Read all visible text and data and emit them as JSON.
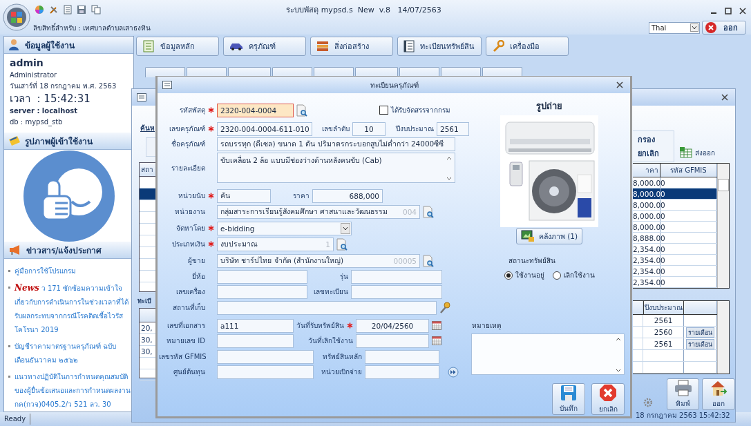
{
  "window": {
    "title": "ระบบพัสดุ mypsd.s  New  v.8   14/07/2563",
    "license": "ลิขสิทธิ์สำหรับ : เทศบาลตำบลเสาธงหิน",
    "language": "Thai",
    "exit": "ออก"
  },
  "user_panel": {
    "heading": "ข้อมูลผู้ใช้งาน",
    "username": "admin",
    "role": "Administrator",
    "date": "วันเสาร์ที่ 18 กรกฎาคม พ.ศ. 2563",
    "time": "เวลา  : 15:42:31",
    "server": "server : localhost",
    "db": "db : mypsd_stb",
    "photo_heading": "รูปภาพผู้เข้าใช้งาน",
    "news_heading": "ข่าวสาร/แจ้งประกาศ",
    "news": [
      {
        "text": "คู่มือการใช้โปรแกรม"
      },
      {
        "badge": "News",
        "text": "ว 171 ซักซ้อมความเข้าใจเกี่ยวกับการดำเนินการในช่วงเวลาที่ได้รับผลกระทบจากกรณีโรคติดเชื้อไวรัสโคโรนา 2019"
      },
      {
        "text": "บัญชีราคามาตรฐานครุภัณฑ์ ฉบับเดือนธันวาคม ๒๕๖๒"
      },
      {
        "text": "แนวทางปฏิบัติในการกำหนดคุณสมบัติของผู้ยื่นข้อเสนอและการกำหนดผลงาน กค(กวจ)0405.2/ว 521 ลว. 30"
      }
    ]
  },
  "menu": [
    "ข้อมูลหลัก",
    "ครุภัณฑ์",
    "สิ่งก่อสร้าง",
    "ทะเบียนทรัพย์สิน",
    "เครื่องมือ"
  ],
  "list_window": {
    "search_label": "ค้นห",
    "filter": "กรอง",
    "clear": "ยกเลิก",
    "export": "ส่งออก",
    "columns": [
      "สถา",
      "าคา",
      "รหัส GFMIS"
    ],
    "rows": [
      {
        "price": "8,000.00",
        "selected": false
      },
      {
        "price": "8,000.00",
        "selected": true
      },
      {
        "price": "8,000.00",
        "selected": false
      },
      {
        "price": "8,000.00",
        "selected": false
      },
      {
        "price": "8,000.00",
        "selected": false
      },
      {
        "price": "8,888.00",
        "selected": false
      },
      {
        "price": "2,354.00",
        "selected": false
      },
      {
        "price": "2,354.00",
        "selected": false
      },
      {
        "price": "2,354.00",
        "selected": false
      },
      {
        "price": "2,354.00",
        "selected": false
      }
    ],
    "history_label": "ทะเบี",
    "history_columns": [
      "ปีงบประมาณ"
    ],
    "history_rows": [
      {
        "amount": "20,",
        "year": "2561"
      },
      {
        "amount": "30,",
        "year": "2560",
        "action": "รายเดือน"
      },
      {
        "amount": "30,",
        "year": "2561",
        "action": "รายเดือน"
      }
    ],
    "print": "พิมพ์",
    "exit": "ออก",
    "timestamp": "18 กรกฎาคม 2563 15:42:32"
  },
  "dialog": {
    "title": "ทะเบียนครุภัณฑ์",
    "rows": [
      {
        "fields": [
          {
            "kind": "text",
            "label": "รหัสพัสดุ",
            "required": true,
            "value": "2320-004-0004",
            "highlighted": true,
            "button": {
              "kind": "lookup"
            }
          },
          {
            "kind": "checkbox",
            "label": "ได้รับจัดสรรจากกรม",
            "checked": false
          }
        ]
      },
      {
        "fields": [
          {
            "kind": "text",
            "label": "เลขครุภัณฑ์",
            "required": true,
            "value": "2320-004-0004-611-010"
          },
          {
            "kind": "text",
            "label": "เลขลำดับ",
            "value": "10"
          },
          {
            "kind": "text",
            "label": "ปีงบประมาณ",
            "value": "2561"
          }
        ]
      },
      {
        "fields": [
          {
            "kind": "text",
            "label": "ชื่อครุภัณฑ์",
            "value": "รถบรรทุก (ดีเซล) ขนาด 1 ตัน ปริมาตรกระบอกสูบไม่ต่ำกว่า 24000ซีซี"
          }
        ]
      },
      {
        "fields": [
          {
            "kind": "textarea",
            "label": "รายละเอียด",
            "value": "ขับเคลื่อน 2 ล้อ แบบมีช่องว่างด้านหลังคนขับ (Cab)"
          }
        ]
      },
      {
        "fields": [
          {
            "kind": "text",
            "label": "หน่วยนับ",
            "required": true,
            "value": "คัน"
          },
          {
            "kind": "text",
            "label": "ราคา",
            "value": "688,000"
          }
        ]
      },
      {
        "fields": [
          {
            "kind": "text",
            "label": "หน่วยงาน",
            "value": "กลุ่มสาระการเรียนรู้สังคมศึกษา  ศาสนาและวัฒนธรรม",
            "code": "004",
            "button": {
              "kind": "lookup"
            }
          }
        ]
      },
      {
        "fields": [
          {
            "kind": "select",
            "label": "จัดหาโดย",
            "required": true,
            "value": "e-bidding"
          }
        ]
      },
      {
        "fields": [
          {
            "kind": "text",
            "label": "ประเภทเงิน",
            "required": true,
            "value": "งบประมาณ",
            "code": "1",
            "button": {
              "kind": "lookup"
            }
          }
        ]
      },
      {
        "fields": [
          {
            "kind": "text",
            "label": "ผู้ขาย",
            "value": "บริษัท ชาร์ปไทย จำกัด (สำนักงานใหญ่)",
            "code": "00005",
            "button": {
              "kind": "lookup"
            }
          }
        ]
      },
      {
        "fields": [
          {
            "kind": "text",
            "label": "ยี่ห้อ"
          },
          {
            "kind": "text",
            "label": "รุ่น"
          }
        ]
      },
      {
        "fields": [
          {
            "kind": "text",
            "label": "เลขเครื่อง"
          },
          {
            "kind": "text",
            "label": "เลขทะเบียน"
          }
        ]
      },
      {
        "fields": [
          {
            "kind": "text",
            "label": "สถานที่เก็บ",
            "button": {
              "kind": "key"
            }
          }
        ]
      },
      {
        "fields": [
          {
            "kind": "text",
            "label": "เลขที่เอกสาร",
            "value": "a111"
          },
          {
            "kind": "text",
            "label": "วันที่รับทรัพย์สิน",
            "required": true,
            "value": "20/04/2560",
            "button": {
              "kind": "calendar"
            }
          }
        ]
      },
      {
        "fields": [
          {
            "kind": "text",
            "label": "หมายเลข ID"
          },
          {
            "kind": "text",
            "label": "วันที่เลิกใช้งาน",
            "button": {
              "kind": "calendar"
            }
          }
        ]
      },
      {
        "fields": [
          {
            "kind": "text",
            "label": "เลขรหัส GFMIS"
          },
          {
            "kind": "text",
            "label": "ทรัพย์สินหลัก"
          }
        ]
      },
      {
        "fields": [
          {
            "kind": "text",
            "label": "ศูนย์ต้นทุน"
          },
          {
            "kind": "text",
            "label": "หน่วยเบิกจ่าย",
            "button": {
              "kind": "next"
            }
          }
        ]
      }
    ],
    "photo_heading": "รูปถ่าย",
    "gallery_button": "คลังภาพ (1)",
    "status_label": "สถานะทรัพย์สิน",
    "status_options": [
      {
        "label": "ใช้งานอยู่",
        "selected": true
      },
      {
        "label": "เลิกใช้งาน",
        "selected": false
      }
    ],
    "note_label": "หมายเหตุ",
    "save": "บันทึก",
    "cancel": "ยกเลิก"
  },
  "status_bar": "Ready"
}
